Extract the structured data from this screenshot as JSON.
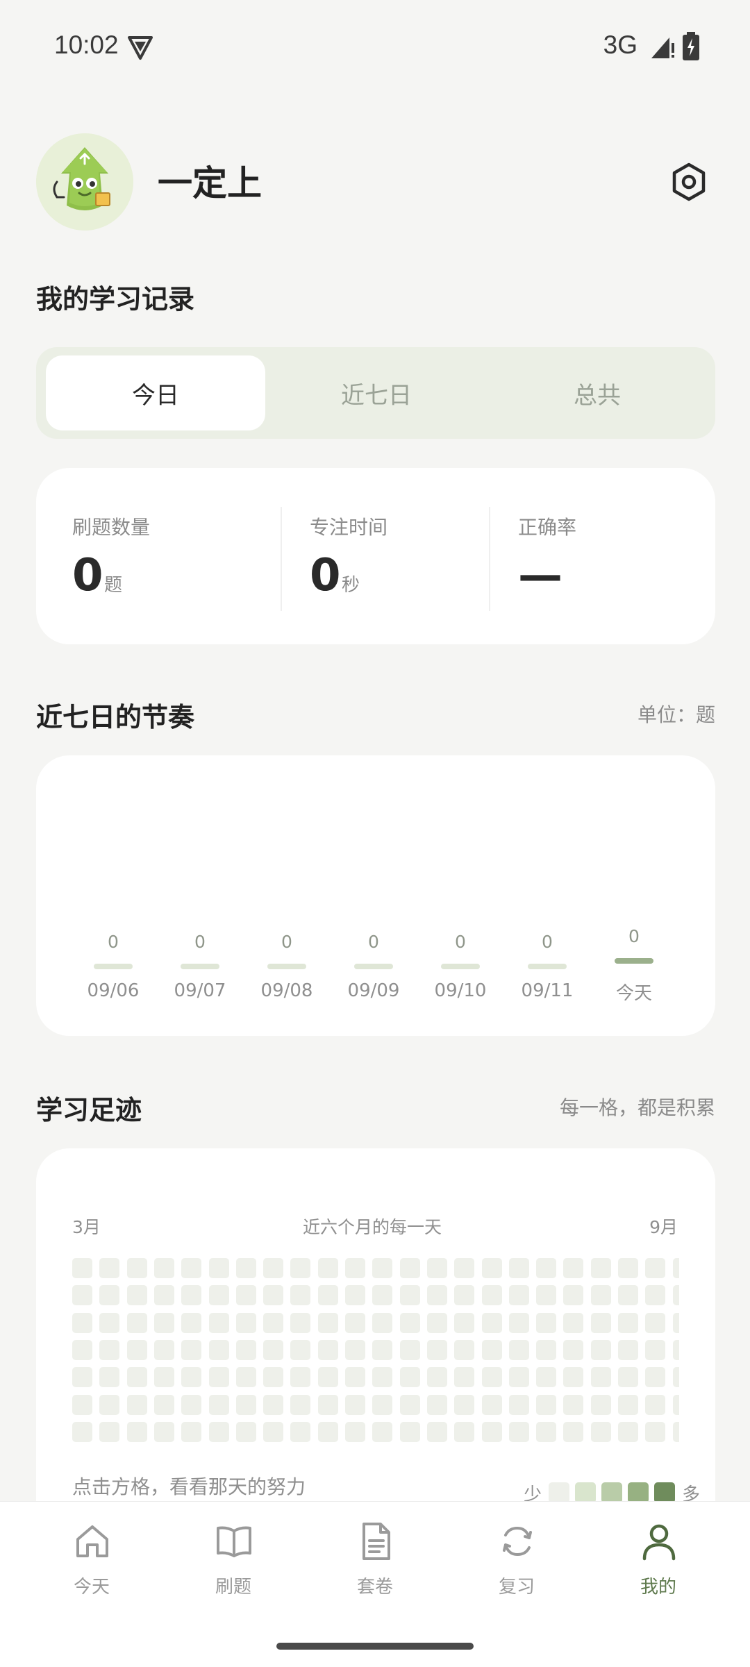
{
  "status_bar": {
    "time": "10:02",
    "network": "3G"
  },
  "profile": {
    "username": "一定上"
  },
  "study_record": {
    "title": "我的学习记录",
    "tabs": [
      {
        "label": "今日",
        "active": true
      },
      {
        "label": "近七日",
        "active": false
      },
      {
        "label": "总共",
        "active": false
      }
    ],
    "stats": [
      {
        "label": "刷题数量",
        "value": "0",
        "unit": "题"
      },
      {
        "label": "专注时间",
        "value": "0",
        "unit": "秒"
      },
      {
        "label": "正确率",
        "value": "—",
        "unit": ""
      }
    ]
  },
  "rhythm": {
    "title": "近七日的节奏",
    "unit_note": "单位：题",
    "days": [
      {
        "date": "09/06",
        "value": "0"
      },
      {
        "date": "09/07",
        "value": "0"
      },
      {
        "date": "09/08",
        "value": "0"
      },
      {
        "date": "09/09",
        "value": "0"
      },
      {
        "date": "09/10",
        "value": "0"
      },
      {
        "date": "09/11",
        "value": "0"
      },
      {
        "date": "今天",
        "value": "0"
      }
    ]
  },
  "footprint": {
    "title": "学习足迹",
    "note": "每一格，都是积累",
    "start_month": "3月",
    "caption": "近六个月的每一天",
    "end_month": "9月",
    "hint": "点击方格，看看那天的努力",
    "legend_less": "少",
    "legend_more": "多",
    "legend_colors": [
      "#eef0ea",
      "#d9e5cd",
      "#b9cca8",
      "#97b182",
      "#6f8c5c"
    ]
  },
  "bottom_nav": [
    {
      "label": "今天",
      "icon": "home-icon",
      "active": false
    },
    {
      "label": "刷题",
      "icon": "book-icon",
      "active": false
    },
    {
      "label": "套卷",
      "icon": "document-icon",
      "active": false
    },
    {
      "label": "复习",
      "icon": "refresh-icon",
      "active": false
    },
    {
      "label": "我的",
      "icon": "person-icon",
      "active": true
    }
  ]
}
